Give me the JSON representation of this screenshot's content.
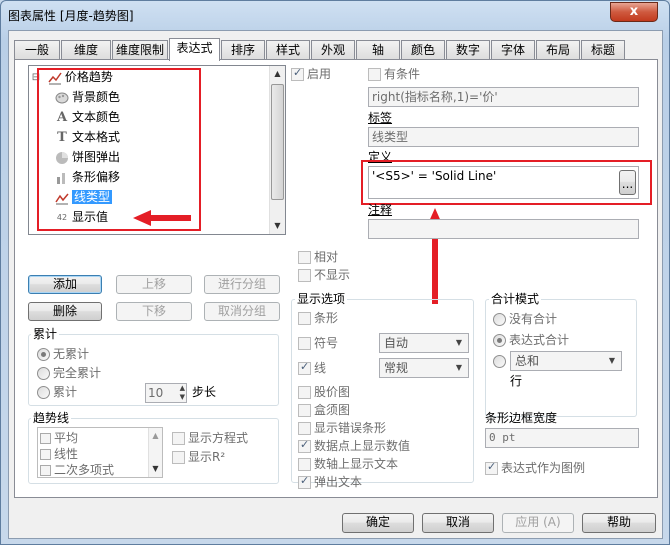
{
  "window": {
    "title": "图表属性 [月度-趋势图]",
    "close_glyph": "x"
  },
  "tabs": [
    {
      "label": "一般",
      "active": false
    },
    {
      "label": "维度",
      "active": false
    },
    {
      "label": "维度限制",
      "active": false
    },
    {
      "label": "表达式",
      "active": true
    },
    {
      "label": "排序",
      "active": false
    },
    {
      "label": "样式",
      "active": false
    },
    {
      "label": "外观",
      "active": false
    },
    {
      "label": "轴",
      "active": false
    },
    {
      "label": "颜色",
      "active": false
    },
    {
      "label": "数字",
      "active": false
    },
    {
      "label": "字体",
      "active": false
    },
    {
      "label": "布局",
      "active": false
    },
    {
      "label": "标题",
      "active": false
    }
  ],
  "tree": {
    "expand_glyph": "⊟",
    "root": {
      "label": "价格趋势",
      "icon": "line-chart-icon"
    },
    "children": [
      {
        "label": "背景颜色",
        "icon": "palette-icon",
        "selected": false
      },
      {
        "label": "文本颜色",
        "icon": "letter-a-icon",
        "selected": false
      },
      {
        "label": "文本格式",
        "icon": "letter-t-icon",
        "selected": false
      },
      {
        "label": "饼图弹出",
        "icon": "pie-icon",
        "selected": false
      },
      {
        "label": "条形偏移",
        "icon": "bar-offset-icon",
        "selected": false
      },
      {
        "label": "线类型",
        "icon": "line-type-icon",
        "selected": true
      },
      {
        "label": "显示值",
        "icon": "number-icon",
        "selected": false
      }
    ],
    "icon_glyphs": {
      "letter-a-icon": "A",
      "letter-t-icon": "T",
      "number-icon": "42"
    }
  },
  "expr_buttons": {
    "add": "添加",
    "up": "上移",
    "group": "进行分组",
    "delete": "删除",
    "down": "下移",
    "ungroup": "取消分组"
  },
  "accumulation": {
    "title": "累计",
    "none": "无累计",
    "full": "完全累计",
    "accumulate": "累计",
    "steps_value": "10",
    "steps_label": "步长"
  },
  "trendlines": {
    "title": "趋势线",
    "items": [
      "平均",
      "线性",
      "二次多项式"
    ],
    "show_equation": "显示方程式",
    "show_r2": "显示R²"
  },
  "enable": {
    "label": "启用",
    "checked": true
  },
  "conditional": {
    "label": "有条件",
    "checked": false,
    "value": "right(指标名称,1)='价'"
  },
  "label_field": {
    "title": "标签",
    "value": "线类型"
  },
  "definition": {
    "title": "定义",
    "value": "'<S5>' = 'Solid Line'",
    "browse_label": "..."
  },
  "comment": {
    "title": "注释",
    "value": ""
  },
  "relative": {
    "label": "相对",
    "checked": false
  },
  "invisible": {
    "label": "不显示",
    "checked": false
  },
  "display_options": {
    "title": "显示选项",
    "bar": "条形",
    "symbol": "符号",
    "symbol_value": "自动",
    "line": "线",
    "line_value": "常规",
    "stock": "股价图",
    "box": "盒须图",
    "error": "显示错误条形",
    "values_on_points": "数据点上显示数值",
    "text_on_axis": "数轴上显示文本",
    "popup_text": "弹出文本"
  },
  "total_mode": {
    "title": "合计模式",
    "no_totals": "没有合计",
    "expression_total": "表达式合计",
    "sum_of": "总和",
    "rows": "行"
  },
  "bar_border": {
    "title": "条形边框宽度",
    "value": "0 pt"
  },
  "expression_as_legend": {
    "label": "表达式作为图例",
    "checked": true
  },
  "footer": {
    "ok": "确定",
    "cancel": "取消",
    "apply": "应用 (A)",
    "help": "帮助"
  }
}
